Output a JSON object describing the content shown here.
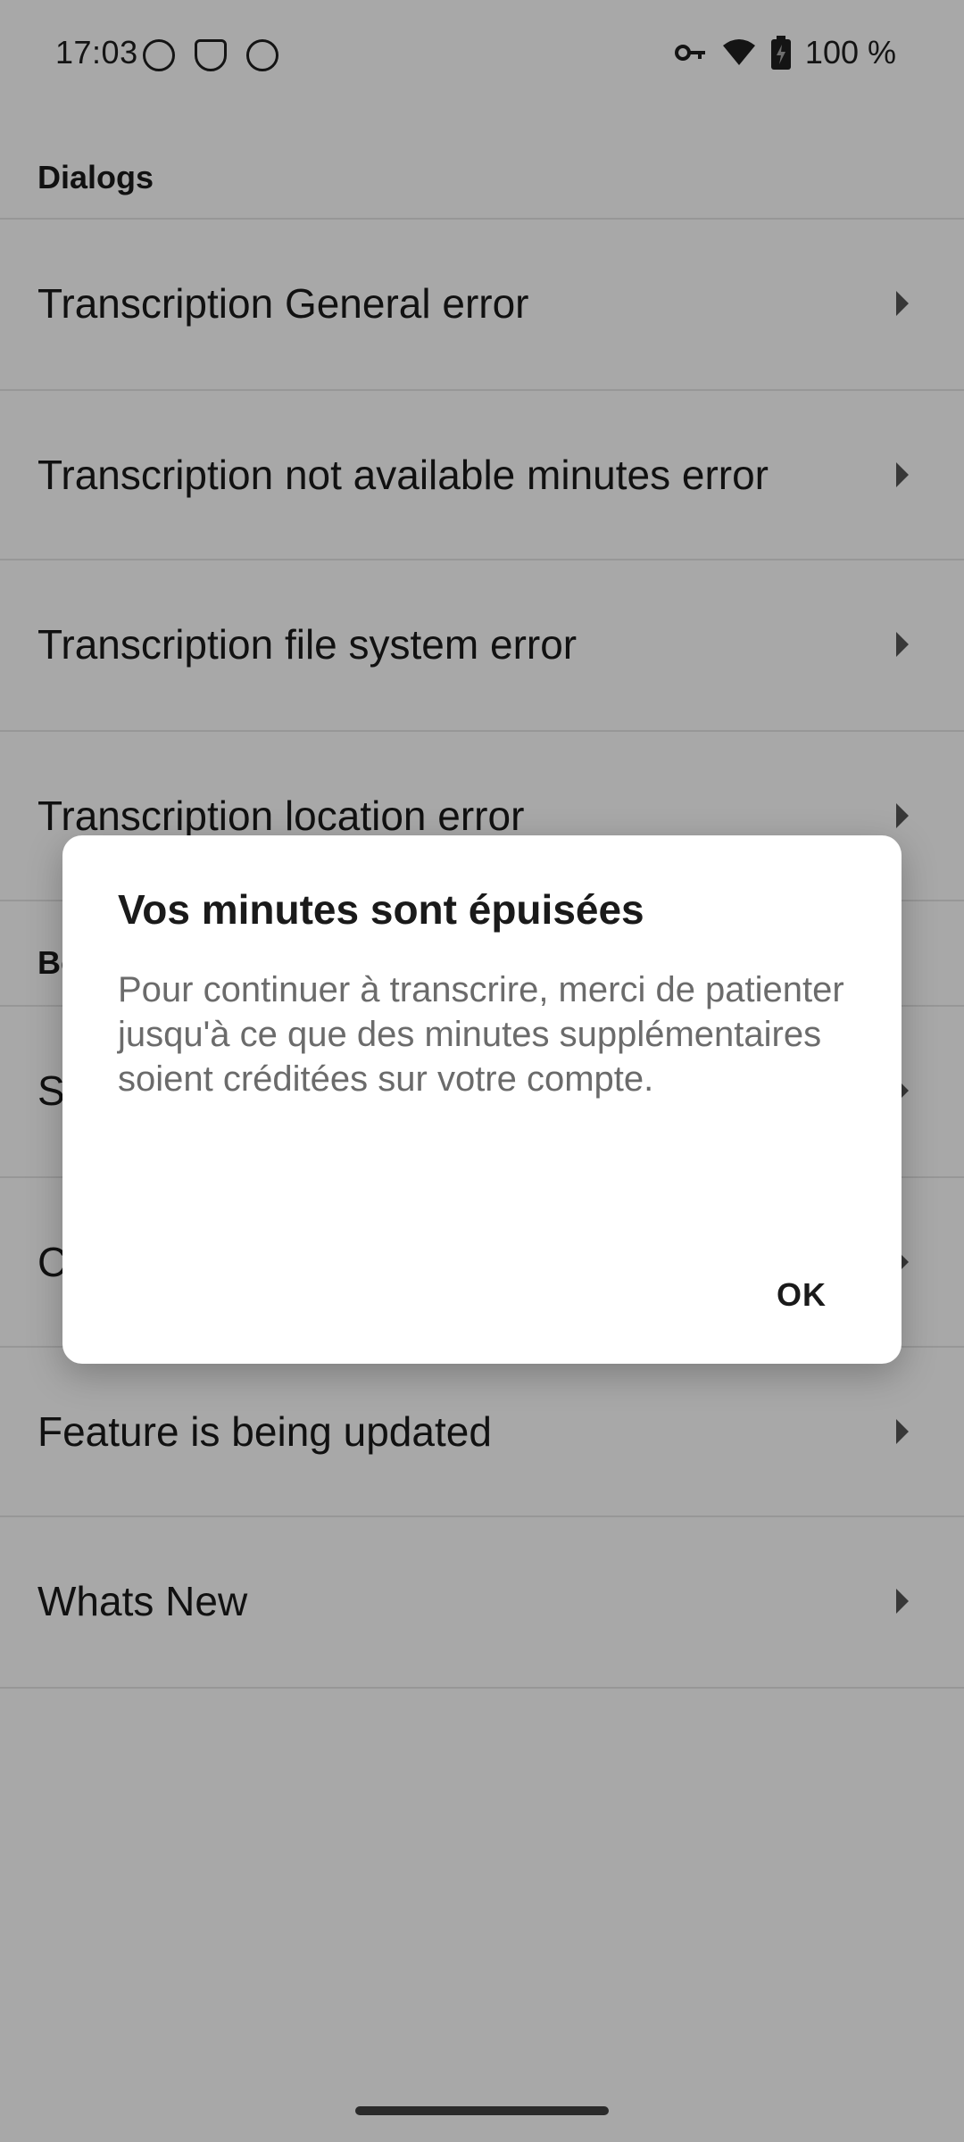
{
  "status_bar": {
    "time": "17:03",
    "battery": "100 %",
    "left_icons": [
      "notification-icon-1",
      "notification-icon-2",
      "notification-icon-3"
    ],
    "right_icons": [
      "vpn-key-icon",
      "wifi-icon",
      "battery-charging-icon"
    ]
  },
  "list": {
    "section_dialogs": "Dialogs",
    "items": [
      {
        "label": "Transcription General error"
      },
      {
        "label": "Transcription not available minutes error"
      },
      {
        "label": "Transcription file system error"
      },
      {
        "label": "Transcription location error"
      }
    ],
    "section_b": "Bo",
    "items_b": [
      {
        "label": "S"
      },
      {
        "label": "C"
      },
      {
        "label": "Feature is being updated"
      },
      {
        "label": "Whats New"
      }
    ]
  },
  "dialog": {
    "title": "Vos minutes sont épuisées",
    "message": "Pour continuer à transcrire, merci de patienter jusqu'à ce que des minutes supplémentaires soient créditées sur votre compte.",
    "ok_label": "OK"
  },
  "colors": {
    "scrim": "#000000",
    "dialog_bg": "#ffffff",
    "text_primary": "#1a1a1a",
    "text_secondary": "#6b6b6b"
  }
}
